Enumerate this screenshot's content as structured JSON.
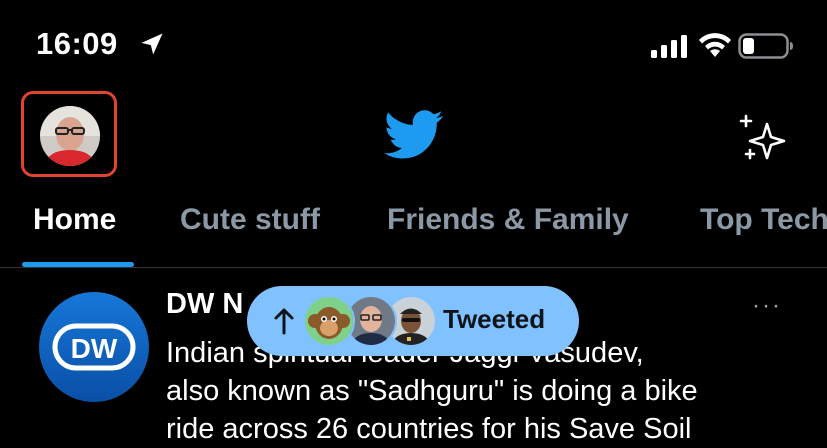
{
  "status_bar": {
    "time": "16:09",
    "icons": [
      "location-arrow-icon",
      "cellular-signal-icon",
      "wifi-icon",
      "battery-icon"
    ]
  },
  "header": {
    "logo_icon": "twitter-bird-icon",
    "sparkle_icon": "sparkle-icon",
    "accent_color": "#1d9bf0",
    "avatar_highlight_color": "#e0442e"
  },
  "tabs": [
    {
      "label": "Home",
      "active": true
    },
    {
      "label": "Cute stuff",
      "active": false
    },
    {
      "label": "Friends & Family",
      "active": false
    },
    {
      "label": "Top Tech",
      "active": false
    }
  ],
  "tweet": {
    "author_visible": "DW N",
    "more_label": "···",
    "logo_text": "DW",
    "body_lines": [
      "Indian spiritual leader Jaggi Vasudev,",
      "also known as \"Sadhguru\" is doing a bike",
      "ride across 26 countries for his Save Soil"
    ]
  },
  "new_tweets_pill": {
    "label": "Tweeted",
    "color": "#80c1ff",
    "icons": [
      "arrow-up-icon",
      "avatar-monkey",
      "avatar-man-glasses",
      "avatar-man-cap"
    ]
  }
}
